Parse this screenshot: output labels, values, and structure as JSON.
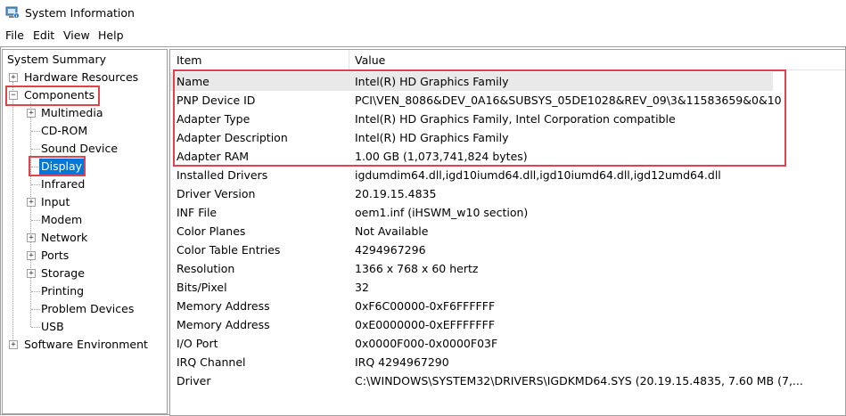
{
  "window": {
    "title": "System Information",
    "icon": "system-information-icon"
  },
  "menu": [
    "File",
    "Edit",
    "View",
    "Help"
  ],
  "tree": {
    "root": "System Summary",
    "hardware_resources": "Hardware Resources",
    "components": "Components",
    "children": [
      "Multimedia",
      "CD-ROM",
      "Sound Device",
      "Display",
      "Infrared",
      "Input",
      "Modem",
      "Network",
      "Ports",
      "Storage",
      "Printing",
      "Problem Devices",
      "USB"
    ],
    "software_environment": "Software Environment",
    "selected": "Display"
  },
  "list": {
    "columns": [
      "Item",
      "Value"
    ],
    "rows": [
      {
        "item": "Name",
        "value": "Intel(R) HD Graphics Family"
      },
      {
        "item": "PNP Device ID",
        "value": "PCI\\VEN_8086&DEV_0A16&SUBSYS_05DE1028&REV_09\\3&11583659&0&10"
      },
      {
        "item": "Adapter Type",
        "value": "Intel(R) HD Graphics Family, Intel Corporation compatible"
      },
      {
        "item": "Adapter Description",
        "value": "Intel(R) HD Graphics Family"
      },
      {
        "item": "Adapter RAM",
        "value": "1.00 GB (1,073,741,824 bytes)"
      },
      {
        "item": "Installed Drivers",
        "value": "igdumdim64.dll,igd10iumd64.dll,igd10iumd64.dll,igd12umd64.dll"
      },
      {
        "item": "Driver Version",
        "value": "20.19.15.4835"
      },
      {
        "item": "INF File",
        "value": "oem1.inf (iHSWM_w10 section)"
      },
      {
        "item": "Color Planes",
        "value": "Not Available"
      },
      {
        "item": "Color Table Entries",
        "value": "4294967296"
      },
      {
        "item": "Resolution",
        "value": "1366 x 768 x 60 hertz"
      },
      {
        "item": "Bits/Pixel",
        "value": "32"
      },
      {
        "item": "Memory Address",
        "value": "0xF6C00000-0xF6FFFFFF"
      },
      {
        "item": "Memory Address",
        "value": "0xE0000000-0xEFFFFFFF"
      },
      {
        "item": "I/O Port",
        "value": "0x0000F000-0x0000F03F"
      },
      {
        "item": "IRQ Channel",
        "value": "IRQ 4294967290"
      },
      {
        "item": "Driver",
        "value": "C:\\WINDOWS\\SYSTEM32\\DRIVERS\\IGDKMD64.SYS (20.19.15.4835, 7.60 MB (7,..."
      }
    ]
  },
  "colors": {
    "selection": "#0078d7",
    "annotation_box": "#e0434b",
    "row_highlight": "#e9e9e9"
  }
}
